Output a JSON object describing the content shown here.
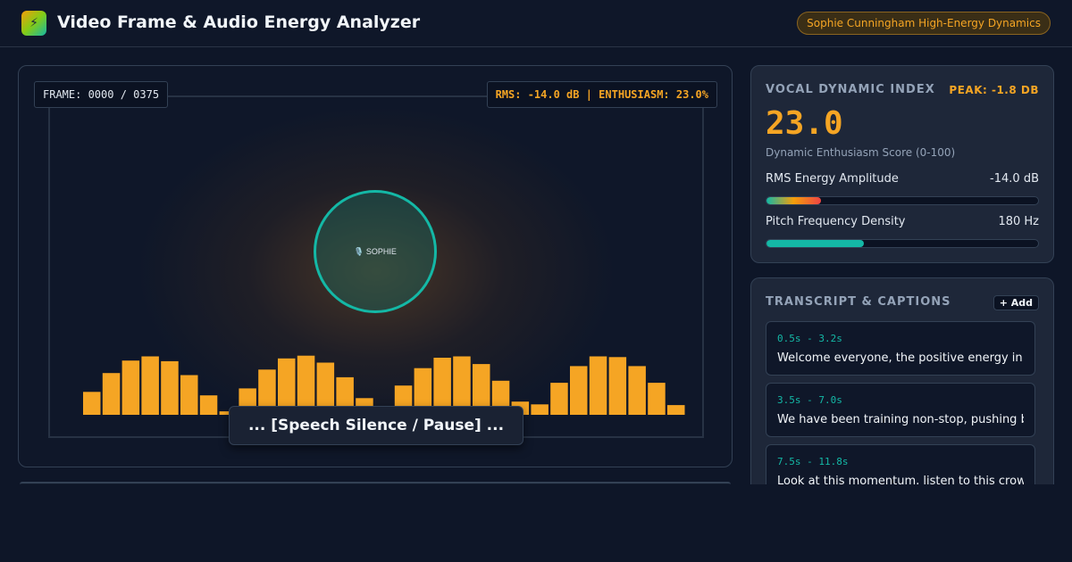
{
  "app": {
    "title": "Video Frame & Audio Energy Analyzer",
    "logo_icon": "lightning-icon",
    "logo_glyph": "⚡",
    "badge": "Sophie Cunningham High-Energy Dynamics"
  },
  "video": {
    "frame_counter": "FRAME: 0000 / 0375",
    "rms_readout": "RMS: -14.0 dB | ENTHUSIASM: 23.0%",
    "speaker_label": "🎙️ SOPHIE",
    "caption": "... [Speech Silence / Pause] ...",
    "bar_levels": [
      0.33,
      0.6,
      0.78,
      0.84,
      0.77,
      0.57,
      0.28,
      0.05,
      0.38,
      0.65,
      0.81,
      0.85,
      0.75,
      0.54,
      0.24,
      0.05,
      0.42,
      0.67,
      0.82,
      0.84,
      0.73,
      0.49,
      0.19,
      0.15,
      0.46,
      0.7,
      0.84,
      0.83,
      0.7,
      0.46,
      0.14
    ]
  },
  "metrics": {
    "title": "VOCAL DYNAMIC INDEX",
    "peak": "PEAK: -1.8 DB",
    "score": "23.0",
    "score_caption": "Dynamic Enthusiasm Score (0-100)",
    "rms_label": "RMS Energy Amplitude",
    "rms_value": "-14.0 dB",
    "rms_fraction": 0.2,
    "pitch_label": "Pitch Frequency Density",
    "pitch_value": "180 Hz",
    "pitch_fraction": 0.36
  },
  "transcript": {
    "title": "TRANSCRIPT & CAPTIONS",
    "add_label": "+ Add",
    "segments": [
      {
        "time": "0.5s - 3.2s",
        "text": "Welcome everyone, the positive energy in this room"
      },
      {
        "time": "3.5s - 7.0s",
        "text": "We have been training non-stop, pushing boundaries"
      },
      {
        "time": "7.5s - 11.8s",
        "text": "Look at this momentum, listen to this crowd, and"
      }
    ]
  },
  "colors": {
    "accent_orange": "#f5a524",
    "accent_teal": "#14b8a6",
    "background": "#0e1628"
  }
}
